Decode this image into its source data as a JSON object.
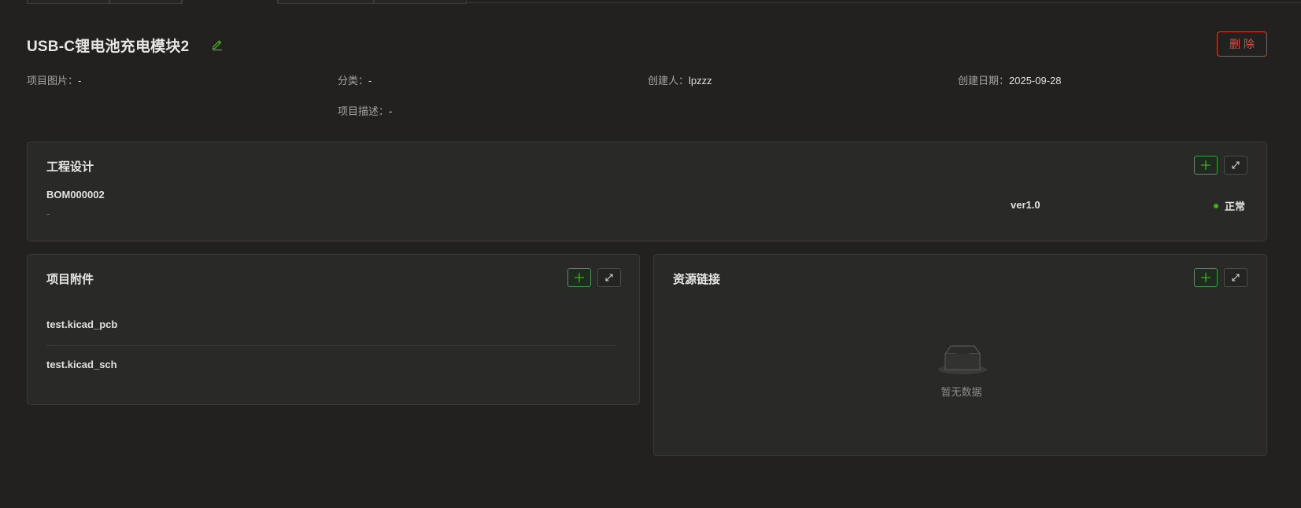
{
  "project": {
    "title": "USB-C锂电池充电模块2",
    "delete_label": "删除"
  },
  "meta": {
    "image_label": "项目图片：",
    "image_value": "-",
    "category_label": "分类：",
    "category_value": "-",
    "creator_label": "创建人：",
    "creator_value": "lpzzz",
    "created_label": "创建日期：",
    "created_value": "2025-09-28",
    "desc_label": "项目描述：",
    "desc_value": "-"
  },
  "engineering": {
    "title": "工程设计",
    "bom_code": "BOM000002",
    "bom_desc": "-",
    "version": "ver1.0",
    "status": "正常",
    "status_color": "#49aa19"
  },
  "attachments": {
    "title": "项目附件",
    "items": [
      "test.kicad_pcb",
      "test.kicad_sch"
    ]
  },
  "resources": {
    "title": "资源链接",
    "empty_text": "暂无数据"
  },
  "icons": {
    "edit": "edit-icon",
    "add": "plus-icon",
    "expand": "expand-icon",
    "empty": "empty-box-icon"
  },
  "colors": {
    "background": "#22211f",
    "card": "#292927",
    "accent_green": "#3f9a4a",
    "danger": "#d9534b"
  }
}
